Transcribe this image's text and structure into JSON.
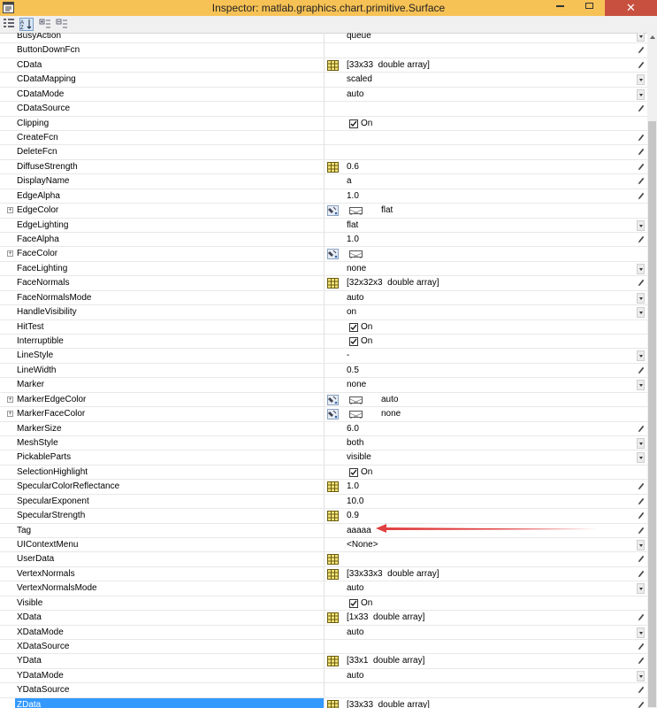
{
  "window": {
    "title": "Inspector:  matlab.graphics.chart.primitive.Surface",
    "close_label": "✕"
  },
  "toolbar": {
    "buttons": [
      "categorize-icon",
      "sort-alphabetical-icon",
      "expand-all-icon",
      "collapse-all-icon"
    ]
  },
  "colors": {
    "titlebar": "#f7c255",
    "selection": "#3399ff",
    "close": "#c7503f",
    "arrow": "#e04040"
  },
  "properties": [
    {
      "name": "BusyAction",
      "value": "queue",
      "icon": "",
      "editor": "dropdown",
      "expander": false
    },
    {
      "name": "ButtonDownFcn",
      "value": "",
      "icon": "",
      "editor": "edit",
      "expander": false
    },
    {
      "name": "CData",
      "value": "[33x33  double array]",
      "icon": "grid",
      "editor": "edit",
      "expander": false
    },
    {
      "name": "CDataMapping",
      "value": "scaled",
      "icon": "",
      "editor": "dropdown",
      "expander": false
    },
    {
      "name": "CDataMode",
      "value": "auto",
      "icon": "",
      "editor": "dropdown",
      "expander": false
    },
    {
      "name": "CDataSource",
      "value": "",
      "icon": "",
      "editor": "edit",
      "expander": false
    },
    {
      "name": "Clipping",
      "value": "On",
      "icon": "",
      "editor": "",
      "type": "check",
      "expander": false
    },
    {
      "name": "CreateFcn",
      "value": "",
      "icon": "",
      "editor": "edit",
      "expander": false
    },
    {
      "name": "DeleteFcn",
      "value": "",
      "icon": "",
      "editor": "edit",
      "expander": false
    },
    {
      "name": "DiffuseStrength",
      "value": "0.6",
      "icon": "grid",
      "editor": "edit",
      "expander": false
    },
    {
      "name": "DisplayName",
      "value": "a",
      "icon": "",
      "editor": "edit",
      "expander": false
    },
    {
      "name": "EdgeAlpha",
      "value": "1.0",
      "icon": "",
      "editor": "edit",
      "expander": false
    },
    {
      "name": "EdgeColor",
      "value": "flat",
      "icon": "paint",
      "editor": "",
      "type": "swatch",
      "expander": true
    },
    {
      "name": "EdgeLighting",
      "value": "flat",
      "icon": "",
      "editor": "dropdown",
      "expander": false
    },
    {
      "name": "FaceAlpha",
      "value": "1.0",
      "icon": "",
      "editor": "edit",
      "expander": false
    },
    {
      "name": "FaceColor",
      "value": "",
      "icon": "paint",
      "editor": "",
      "type": "swatch",
      "expander": true
    },
    {
      "name": "FaceLighting",
      "value": "none",
      "icon": "",
      "editor": "dropdown",
      "expander": false
    },
    {
      "name": "FaceNormals",
      "value": "[32x32x3  double array]",
      "icon": "grid",
      "editor": "edit",
      "expander": false
    },
    {
      "name": "FaceNormalsMode",
      "value": "auto",
      "icon": "",
      "editor": "dropdown",
      "expander": false
    },
    {
      "name": "HandleVisibility",
      "value": "on",
      "icon": "",
      "editor": "dropdown",
      "expander": false
    },
    {
      "name": "HitTest",
      "value": "On",
      "icon": "",
      "editor": "",
      "type": "check",
      "expander": false
    },
    {
      "name": "Interruptible",
      "value": "On",
      "icon": "",
      "editor": "",
      "type": "check",
      "expander": false
    },
    {
      "name": "LineStyle",
      "value": "-",
      "icon": "",
      "editor": "dropdown",
      "expander": false
    },
    {
      "name": "LineWidth",
      "value": "0.5",
      "icon": "",
      "editor": "edit",
      "expander": false
    },
    {
      "name": "Marker",
      "value": "none",
      "icon": "",
      "editor": "dropdown",
      "expander": false
    },
    {
      "name": "MarkerEdgeColor",
      "value": "auto",
      "icon": "paint",
      "editor": "",
      "type": "swatch",
      "expander": true
    },
    {
      "name": "MarkerFaceColor",
      "value": "none",
      "icon": "paint",
      "editor": "",
      "type": "swatch",
      "expander": true
    },
    {
      "name": "MarkerSize",
      "value": "6.0",
      "icon": "",
      "editor": "edit",
      "expander": false
    },
    {
      "name": "MeshStyle",
      "value": "both",
      "icon": "",
      "editor": "dropdown",
      "expander": false
    },
    {
      "name": "PickableParts",
      "value": "visible",
      "icon": "",
      "editor": "dropdown",
      "expander": false
    },
    {
      "name": "SelectionHighlight",
      "value": "On",
      "icon": "",
      "editor": "",
      "type": "check",
      "expander": false
    },
    {
      "name": "SpecularColorReflectance",
      "value": "1.0",
      "icon": "grid",
      "editor": "edit",
      "expander": false
    },
    {
      "name": "SpecularExponent",
      "value": "10.0",
      "icon": "",
      "editor": "edit",
      "expander": false
    },
    {
      "name": "SpecularStrength",
      "value": "0.9",
      "icon": "grid",
      "editor": "edit",
      "expander": false
    },
    {
      "name": "Tag",
      "value": "aaaaa",
      "icon": "",
      "editor": "edit",
      "expander": false
    },
    {
      "name": "UIContextMenu",
      "value": "<None>",
      "icon": "",
      "editor": "dropdown",
      "expander": false
    },
    {
      "name": "UserData",
      "value": "",
      "icon": "grid",
      "editor": "edit",
      "expander": false
    },
    {
      "name": "VertexNormals",
      "value": "[33x33x3  double array]",
      "icon": "grid",
      "editor": "edit",
      "expander": false
    },
    {
      "name": "VertexNormalsMode",
      "value": "auto",
      "icon": "",
      "editor": "dropdown",
      "expander": false
    },
    {
      "name": "Visible",
      "value": "On",
      "icon": "",
      "editor": "",
      "type": "check",
      "expander": false
    },
    {
      "name": "XData",
      "value": "[1x33  double array]",
      "icon": "grid",
      "editor": "edit",
      "expander": false
    },
    {
      "name": "XDataMode",
      "value": "auto",
      "icon": "",
      "editor": "dropdown",
      "expander": false
    },
    {
      "name": "XDataSource",
      "value": "",
      "icon": "",
      "editor": "edit",
      "expander": false
    },
    {
      "name": "YData",
      "value": "[33x1  double array]",
      "icon": "grid",
      "editor": "edit",
      "expander": false
    },
    {
      "name": "YDataMode",
      "value": "auto",
      "icon": "",
      "editor": "dropdown",
      "expander": false
    },
    {
      "name": "YDataSource",
      "value": "",
      "icon": "",
      "editor": "edit",
      "expander": false
    },
    {
      "name": "ZData",
      "value": "[33x33  double array]",
      "icon": "grid",
      "editor": "edit",
      "expander": false,
      "selected": true
    }
  ]
}
